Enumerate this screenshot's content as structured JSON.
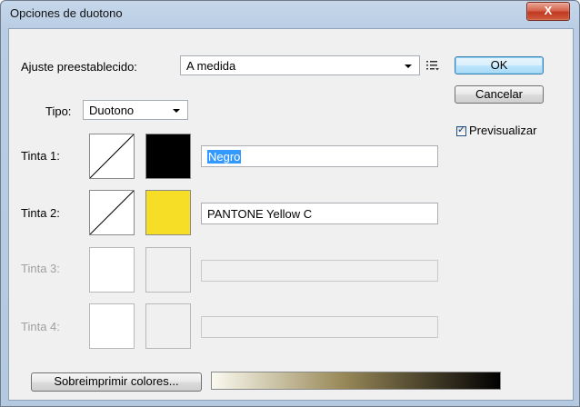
{
  "window": {
    "title": "Opciones de duotono",
    "close_glyph": "X"
  },
  "preset": {
    "label": "Ajuste preestablecido:",
    "value": "A medida",
    "menu_icon": "list-menu-icon"
  },
  "type": {
    "label": "Tipo:",
    "value": "Duotono"
  },
  "inks": [
    {
      "label": "Tinta 1:",
      "color": "#000000",
      "name": "Negro",
      "enabled": true,
      "selected": true
    },
    {
      "label": "Tinta 2:",
      "color": "#f5de25",
      "name": "PANTONE Yellow C",
      "enabled": true,
      "selected": false
    },
    {
      "label": "Tinta 3:",
      "color": "",
      "name": "",
      "enabled": false,
      "selected": false
    },
    {
      "label": "Tinta 4:",
      "color": "",
      "name": "",
      "enabled": false,
      "selected": false
    }
  ],
  "buttons": {
    "ok": "OK",
    "cancel": "Cancelar",
    "overprint": "Sobreimprimir colores..."
  },
  "preview": {
    "label": "Previsualizar",
    "checked": true
  },
  "gradient": {
    "from": "#fbfaf0",
    "mid": "#9a8a5a",
    "to": "#000000"
  }
}
